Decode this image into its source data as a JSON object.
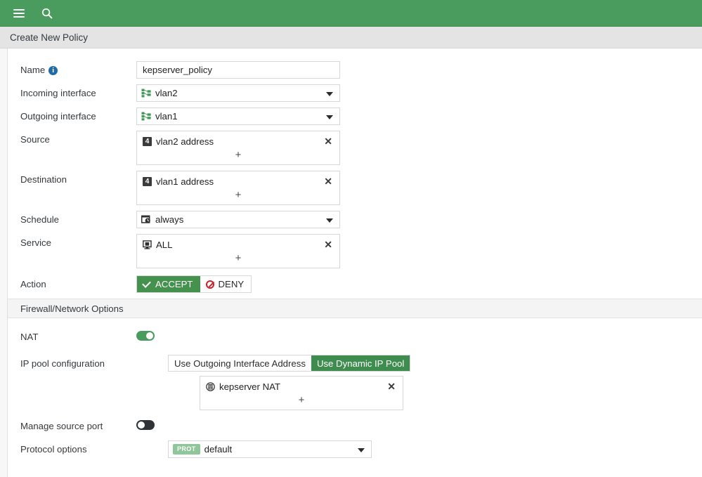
{
  "topbar": {
    "background": "#4a9b5e",
    "menu_icon": "hamburger-menu-icon",
    "search_icon": "search-icon"
  },
  "titlebar": {
    "title": "Create New Policy"
  },
  "form": {
    "name": {
      "label": "Name",
      "info_icon": "info-icon",
      "value": "kepserver_policy",
      "placeholder": ""
    },
    "incoming_interface": {
      "label": "Incoming interface",
      "value": "vlan2",
      "icon": "vlan-interface-icon"
    },
    "outgoing_interface": {
      "label": "Outgoing interface",
      "value": "vlan1",
      "icon": "vlan-interface-icon"
    },
    "source": {
      "label": "Source",
      "items": [
        {
          "icon": "ipv4-address-icon",
          "icon_text": "4",
          "label": "vlan2 address"
        }
      ],
      "add_label": "+",
      "remove_label": "✕"
    },
    "destination": {
      "label": "Destination",
      "items": [
        {
          "icon": "ipv4-address-icon",
          "icon_text": "4",
          "label": "vlan1 address"
        }
      ],
      "add_label": "+",
      "remove_label": "✕"
    },
    "schedule": {
      "label": "Schedule",
      "value": "always",
      "icon": "schedule-clock-icon"
    },
    "service": {
      "label": "Service",
      "items": [
        {
          "icon": "service-monitor-icon",
          "label": "ALL"
        }
      ],
      "add_label": "+",
      "remove_label": "✕"
    },
    "action": {
      "label": "Action",
      "accept_label": "ACCEPT",
      "deny_label": "DENY",
      "selected": "ACCEPT",
      "accept_color": "#45924f"
    }
  },
  "network_section": {
    "title": "Firewall/Network Options",
    "nat": {
      "label": "NAT",
      "state": "on"
    },
    "ip_pool": {
      "label": "IP pool configuration",
      "options": [
        "Use Outgoing Interface Address",
        "Use Dynamic IP Pool"
      ],
      "selected": "Use Dynamic IP Pool",
      "items": [
        {
          "icon": "ip-pool-icon",
          "label": "kepserver NAT"
        }
      ],
      "add_label": "+",
      "remove_label": "✕"
    },
    "manage_source_port": {
      "label": "Manage source port",
      "state": "off"
    },
    "protocol_options": {
      "label": "Protocol options",
      "badge": "PROT",
      "value": "default"
    }
  }
}
